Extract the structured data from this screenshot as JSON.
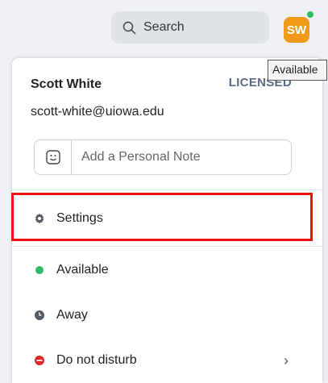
{
  "topbar": {
    "search_label": "Search",
    "avatar_initials": "SW",
    "status_color": "#2bbd63",
    "avatar_color": "#f09a1a",
    "tooltip": "Available"
  },
  "profile": {
    "name": "Scott White",
    "license": "LICENSED",
    "email": "scott-white@uiowa.edu",
    "note_placeholder": "Add a Personal Note"
  },
  "menu": {
    "settings_label": "Settings",
    "available_label": "Available",
    "away_label": "Away",
    "dnd_label": "Do not disturb",
    "available_color": "#2bbd63",
    "away_color": "#555b66",
    "dnd_color": "#e02828"
  },
  "highlight_color": "#e11"
}
